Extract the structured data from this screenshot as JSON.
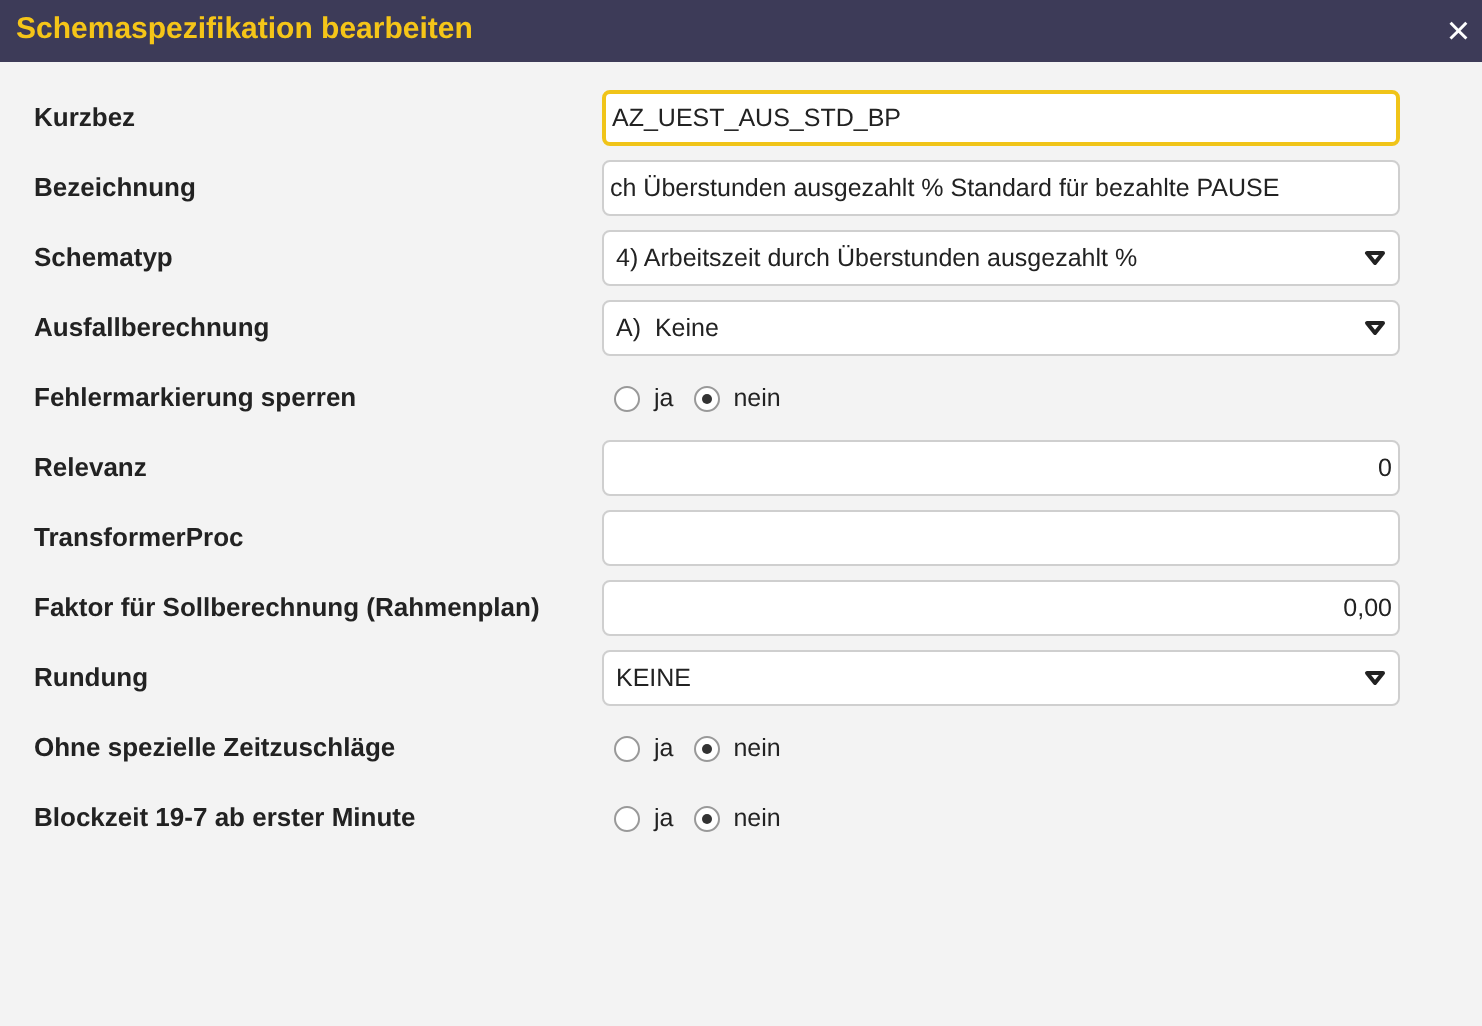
{
  "window": {
    "title": "Schemaspezifikation bearbeiten",
    "close": "×"
  },
  "fields": [
    {
      "label": "Kurzbez",
      "kind": "text",
      "value": "AZ_UEST_AUS_STD_BP",
      "focused": true
    },
    {
      "label": "Bezeichnung",
      "kind": "text",
      "value": "ch Überstunden ausgezahlt % Standard für bezahlte PAUSE",
      "focused": false
    },
    {
      "label": "Schematyp",
      "kind": "select",
      "value": "4) Arbeitszeit durch Überstunden ausgezahlt %"
    },
    {
      "label": "Ausfallberechnung",
      "kind": "select",
      "value": "A)  Keine"
    },
    {
      "label": "Fehlermarkierung sperren",
      "kind": "radio",
      "options": [
        {
          "label": "ja",
          "selected": false
        },
        {
          "label": "nein",
          "selected": true
        }
      ]
    },
    {
      "label": "Relevanz",
      "kind": "number",
      "value": "0",
      "focused": false
    },
    {
      "label": "TransformerProc",
      "kind": "text",
      "focused": false
    },
    {
      "label": "Faktor für Sollberechnung (Rahmenplan)",
      "kind": "number",
      "value": "0,00",
      "focused": false
    },
    {
      "label": "Rundung",
      "kind": "select",
      "value": "KEINE"
    },
    {
      "label": "Ohne spezielle Zeitzuschläge",
      "kind": "radio",
      "options": [
        {
          "label": "ja",
          "selected": false
        },
        {
          "label": "nein",
          "selected": true
        }
      ]
    },
    {
      "label": "Blockzeit 19-7 ab erster Minute",
      "kind": "radio",
      "options": [
        {
          "label": "ja",
          "selected": false
        },
        {
          "label": "nein",
          "selected": true
        }
      ]
    }
  ]
}
